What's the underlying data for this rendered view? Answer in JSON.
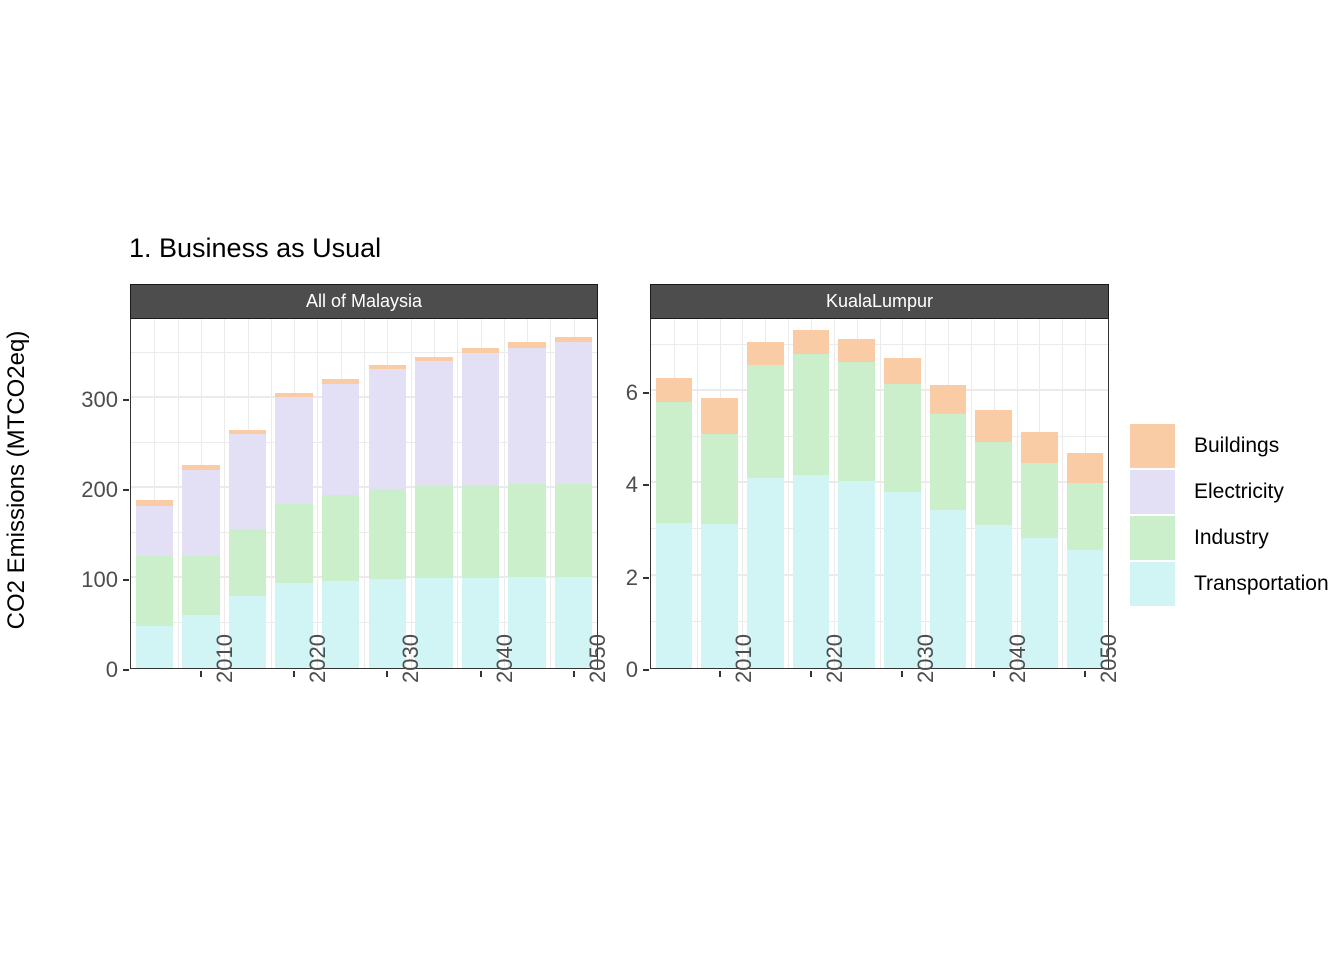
{
  "figure": {
    "title": "1. Business as Usual",
    "y_axis_title": "CO2 Emissions (MTCO2eq)",
    "background": "#ffffff",
    "strip_background": "#4d4d4d",
    "strip_text_color": "#ffffff",
    "grid_color": "#ebebeb",
    "axis_text_color": "#4d4d4d"
  },
  "legend": {
    "position": "right",
    "items": [
      {
        "label": "Buildings",
        "color": "#facca6"
      },
      {
        "label": "Electricity",
        "color": "#e3e0f5"
      },
      {
        "label": "Industry",
        "color": "#ccefcb"
      },
      {
        "label": "Transportation",
        "color": "#d1f4f4"
      }
    ]
  },
  "chart_data": [
    {
      "type": "bar",
      "stacked": true,
      "panel": "All of Malaysia",
      "title": "1. Business as Usual",
      "xlabel": "",
      "ylabel": "CO2 Emissions (MTCO2eq)",
      "ylim": [
        0,
        390
      ],
      "yticks": [
        0,
        100,
        200,
        300
      ],
      "ytick_labels": [
        "0",
        "100",
        "200",
        "300"
      ],
      "grid": true,
      "x": [
        2005,
        2010,
        2015,
        2020,
        2025,
        2030,
        2035,
        2040,
        2045,
        2050
      ],
      "xtick_values": [
        2010,
        2020,
        2030,
        2040,
        2050
      ],
      "xtick_labels": [
        "2010",
        "2020",
        "2030",
        "2040",
        "2050"
      ],
      "series": [
        {
          "name": "Transportation",
          "color": "#d1f4f4",
          "values": [
            47,
            59,
            80,
            95,
            97,
            99,
            100,
            100,
            101,
            101
          ]
        },
        {
          "name": "Industry",
          "color": "#ccefcb",
          "values": [
            78,
            65,
            75,
            87,
            95,
            100,
            102,
            103,
            103,
            103
          ]
        },
        {
          "name": "Electricity",
          "color": "#e3e0f5",
          "values": [
            55,
            96,
            105,
            119,
            124,
            133,
            139,
            147,
            152,
            158
          ]
        },
        {
          "name": "Buildings",
          "color": "#facca6",
          "values": [
            7,
            6,
            5,
            5,
            5,
            5,
            5,
            6,
            6,
            6
          ]
        }
      ],
      "totals": [
        187,
        226,
        265,
        306,
        321,
        337,
        346,
        356,
        362,
        368
      ]
    },
    {
      "type": "bar",
      "stacked": true,
      "panel": "KualaLumpur",
      "xlabel": "",
      "ylabel": "CO2 Emissions (MTCO2eq)",
      "ylim": [
        0,
        7.6
      ],
      "yticks": [
        0,
        2,
        4,
        6
      ],
      "ytick_labels": [
        "0",
        "2",
        "4",
        "6"
      ],
      "grid": true,
      "x": [
        2005,
        2010,
        2015,
        2020,
        2025,
        2030,
        2035,
        2040,
        2045,
        2050
      ],
      "xtick_values": [
        2010,
        2020,
        2030,
        2040,
        2050
      ],
      "xtick_labels": [
        "2010",
        "2020",
        "2030",
        "2040",
        "2050"
      ],
      "series": [
        {
          "name": "Transportation",
          "color": "#d1f4f4",
          "values": [
            3.15,
            3.12,
            4.12,
            4.18,
            4.05,
            3.82,
            3.42,
            3.1,
            2.82,
            2.56
          ]
        },
        {
          "name": "Industry",
          "color": "#ccefcb",
          "values": [
            2.62,
            1.95,
            2.45,
            2.62,
            2.58,
            2.32,
            2.08,
            1.8,
            1.62,
            1.45
          ]
        },
        {
          "name": "Electricity",
          "color": "#e3e0f5",
          "values": [
            0,
            0,
            0,
            0,
            0,
            0,
            0,
            0,
            0,
            0
          ]
        },
        {
          "name": "Buildings",
          "color": "#facca6",
          "values": [
            0.52,
            0.78,
            0.5,
            0.52,
            0.5,
            0.58,
            0.62,
            0.68,
            0.68,
            0.65
          ]
        }
      ],
      "totals": [
        6.29,
        5.85,
        7.07,
        7.32,
        7.13,
        6.72,
        6.12,
        5.58,
        5.12,
        4.66
      ]
    }
  ]
}
